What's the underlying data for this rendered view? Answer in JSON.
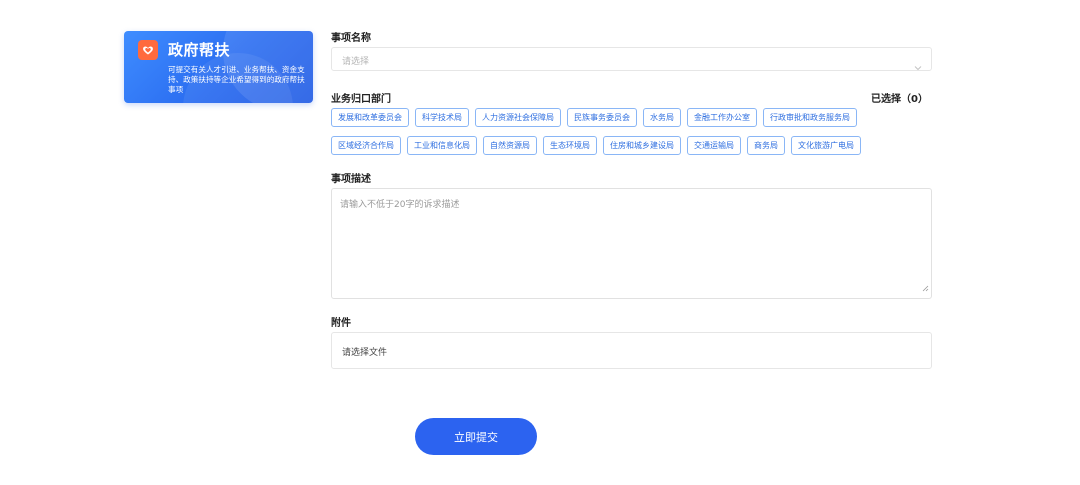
{
  "promo": {
    "title": "政府帮扶",
    "description": "可提交有关人才引进、业务帮扶、资金支持、政策扶持等企业希望得到的政府帮扶事项",
    "icon": "heart-badge-icon",
    "gradient_start": "#3f8dff",
    "gradient_end": "#1f5ae4"
  },
  "form": {
    "item_name_label": "事项名称",
    "item_name_placeholder": "请选择",
    "department_label": "业务归口部门",
    "selected_count": "已选择（0）",
    "departments_row1": [
      "发展和改革委员会",
      "科学技术局",
      "人力资源社会保障局",
      "民族事务委员会",
      "水务局",
      "金融工作办公室",
      "行政审批和政务服务局"
    ],
    "departments_row2": [
      "区域经济合作局",
      "工业和信息化局",
      "自然资源局",
      "生态环境局",
      "住房和城乡建设局",
      "交通运输局",
      "商务局",
      "文化旅游广电局"
    ],
    "description_label": "事项描述",
    "description_placeholder": "请输入不低于20字的诉求描述",
    "attachment_label": "附件",
    "attachment_placeholder": "请选择文件",
    "submit_label": "立即提交"
  },
  "colors": {
    "accent": "#2c63f0",
    "tag_border": "#8ab6f6",
    "tag_text": "#2f6fe0"
  }
}
